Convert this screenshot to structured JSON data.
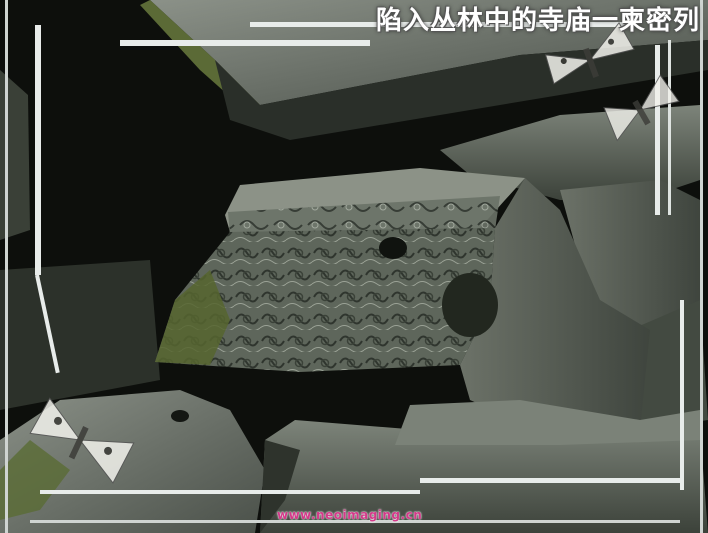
{
  "title": "陷入丛林中的寺庙一柬密列",
  "watermark": "www.neoimaging.cn",
  "colors": {
    "background": "#0d0f0c",
    "stone": "#6f766d",
    "moss": "#5d6b3a",
    "frame": "#e8ecea"
  },
  "decorations": [
    "moth-icon",
    "moth-icon",
    "moth-icon"
  ]
}
